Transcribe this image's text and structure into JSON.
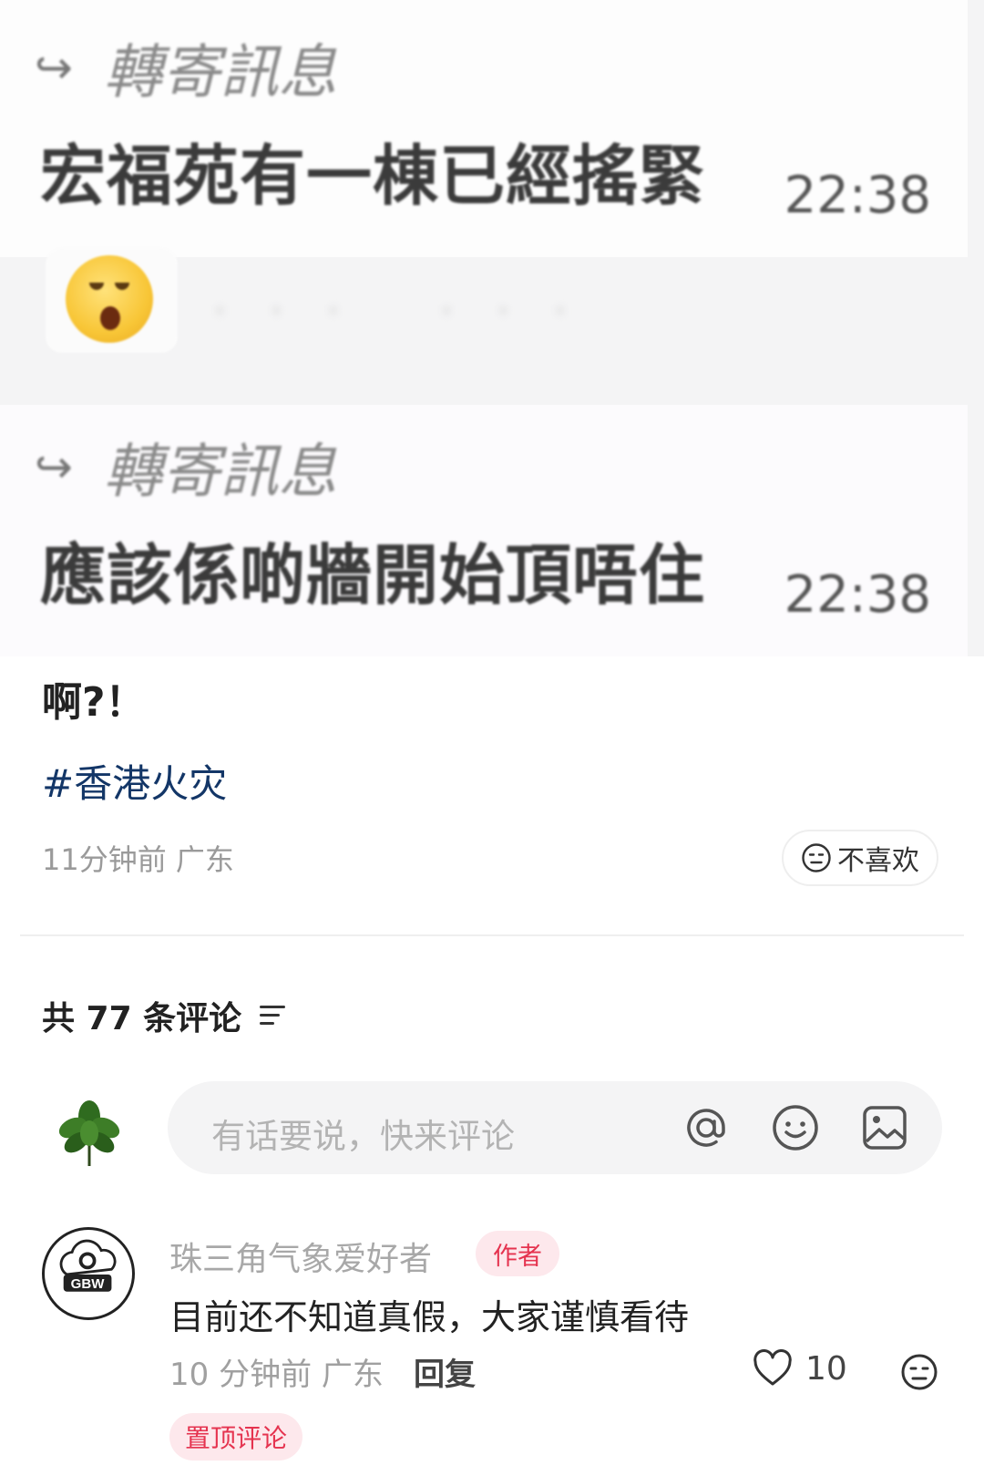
{
  "chat_screenshot": {
    "messages": [
      {
        "forward_label": "轉寄訊息",
        "text": "宏福苑有一棟已經搖緊",
        "time": "22:38"
      },
      {
        "forward_label": "轉寄訊息",
        "text": "應該係啲牆開始頂唔住",
        "time": "22:38"
      }
    ],
    "emoji": "astonished-face"
  },
  "post": {
    "text": "啊?！",
    "hashtag": "#香港火灾",
    "meta": "11分钟前 广东",
    "dislike_label": "不喜欢"
  },
  "comments": {
    "header": "共 77 条评论",
    "input_placeholder": "有话要说，快来评论",
    "items": [
      {
        "username": "珠三角气象爱好者",
        "badge": "作者",
        "text": "目前还不知道真假，大家谨慎看待",
        "time_location": "10 分钟前 广东",
        "reply_label": "回复",
        "likes": "10",
        "pinned_label": "置顶评论"
      }
    ]
  },
  "colors": {
    "hashtag": "#133667",
    "badge_text": "#e5334f",
    "badge_bg": "#fde8ec"
  }
}
